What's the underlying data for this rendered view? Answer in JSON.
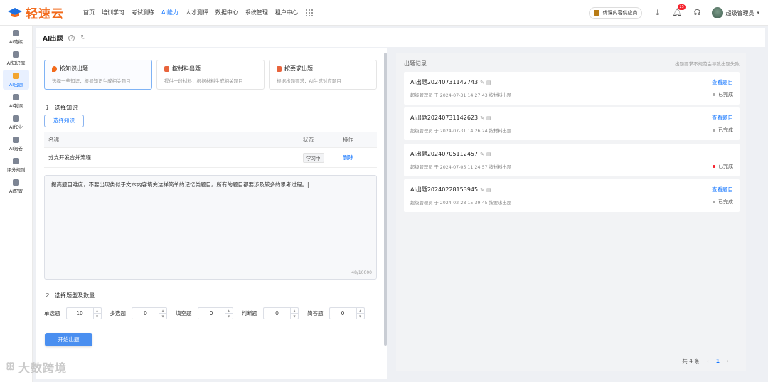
{
  "header": {
    "brand": "轻速云",
    "nav": [
      "首页",
      "培训学习",
      "考试测练",
      "AI能力",
      "人才测评",
      "数据中心",
      "系统管理",
      "租户中心"
    ],
    "active_nav_index": 3,
    "quality_app": "优课内容供应商",
    "bell_count": "25",
    "user_name": "超级管理员"
  },
  "sidebar": {
    "items": [
      {
        "label": "AI陪练",
        "icon": "robot-icon"
      },
      {
        "label": "AI知识库",
        "icon": "user-icon"
      },
      {
        "label": "AI出题",
        "icon": "warning-icon"
      },
      {
        "label": "AI制课",
        "icon": "book-icon"
      },
      {
        "label": "AI作业",
        "icon": "edit-icon"
      },
      {
        "label": "AI阅卷",
        "icon": "document-icon"
      },
      {
        "label": "评分规则",
        "icon": "rules-icon"
      },
      {
        "label": "AI配置",
        "icon": "gear-icon"
      }
    ],
    "active_index": 2
  },
  "page": {
    "title": "AI出题"
  },
  "modes": [
    {
      "title": "按知识出题",
      "desc": "选择一些知识，根据知识生成相关题目",
      "color": "#f26b1d"
    },
    {
      "title": "按材料出题",
      "desc": "提供一段材料，根据材料生成相关题目",
      "color": "#e8643c"
    },
    {
      "title": "按要求出题",
      "desc": "根据出题要求，AI生成对应题目",
      "color": "#e8643c"
    }
  ],
  "step1": {
    "num": "1",
    "label": "选择知识",
    "button": "选择知识"
  },
  "table": {
    "headers": [
      "名称",
      "状态",
      "操作"
    ],
    "rows": [
      {
        "name": "分支开发合并流程",
        "status": "学习中",
        "action": "删除"
      }
    ]
  },
  "requirement": {
    "text": "提高题目难度，不要出现类似于文本内容填充这样简单的记忆类题目。所有的题目都要涉及较多的思考过程。",
    "count": "48/10000"
  },
  "step2": {
    "num": "2",
    "label": "选择题型及数量"
  },
  "question_types": [
    {
      "label": "单选题",
      "value": "10"
    },
    {
      "label": "多选题",
      "value": "0"
    },
    {
      "label": "填空题",
      "value": "0"
    },
    {
      "label": "判断题",
      "value": "0"
    },
    {
      "label": "简答题",
      "value": "0"
    }
  ],
  "submit_label": "开始出题",
  "watermark": "大数跨境",
  "records": {
    "title": "出题记录",
    "hint": "出题要求不规范会导致出题失败",
    "items": [
      {
        "name": "AI出题20240731142743",
        "meta": "超级管理员 于 2024-07-31 14:27:43 按材料出题",
        "view": "查看题目",
        "status": "已完成",
        "dot": "#aaaaaa"
      },
      {
        "name": "AI出题20240731142623",
        "meta": "超级管理员 于 2024-07-31 14:26:24 按材料出题",
        "view": "查看题目",
        "status": "已完成",
        "dot": "#aaaaaa"
      },
      {
        "name": "AI出题20240705112457",
        "meta": "超级管理员 于 2024-07-05 11:24:57 按材料出题",
        "view": "",
        "status": "已完成",
        "dot": "#f5222d"
      },
      {
        "name": "AI出题20240228153945",
        "meta": "超级管理员 于 2024-02-28 15:39:45 按要求出题",
        "view": "查看题目",
        "status": "已完成",
        "dot": "#aaaaaa"
      }
    ],
    "total": "共 4 条",
    "page": "1"
  }
}
